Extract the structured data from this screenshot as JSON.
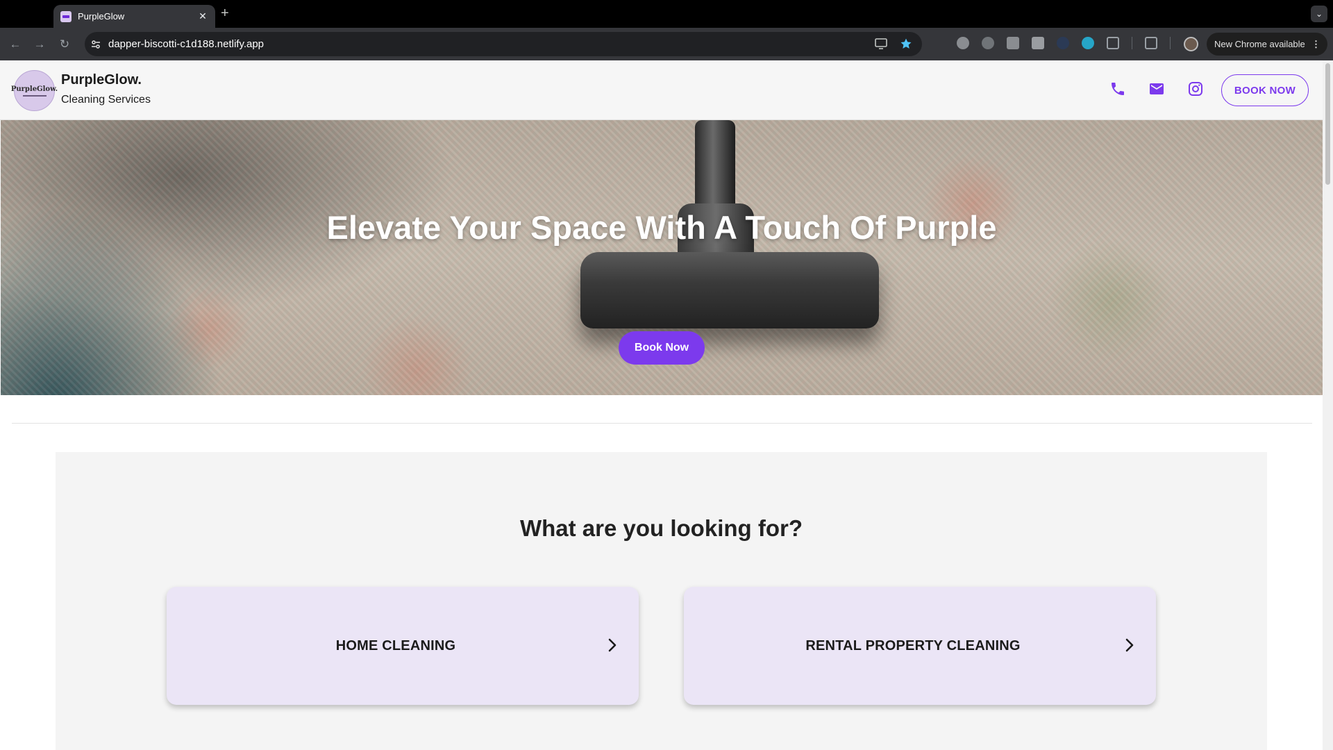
{
  "browser": {
    "tab_title": "PurpleGlow",
    "tab_close": "✕",
    "new_tab": "+",
    "url": "dapper-biscotti-c1d188.netlify.app",
    "update_label": "New Chrome available",
    "update_menu": "⋮"
  },
  "header": {
    "logo_text": "PurpleGlow.",
    "brand_name": "PurpleGlow.",
    "tagline": "Cleaning Services",
    "book_label": "BOOK NOW",
    "icons": [
      "phone-icon",
      "mail-icon",
      "instagram-icon"
    ],
    "accent_color": "#7c3aed"
  },
  "hero": {
    "title": "Elevate Your Space With A Touch Of Purple",
    "button_label": "Book Now"
  },
  "services": {
    "title": "What are you looking for?",
    "cards": [
      {
        "label": "HOME CLEANING"
      },
      {
        "label": "RENTAL PROPERTY CLEANING"
      }
    ]
  }
}
